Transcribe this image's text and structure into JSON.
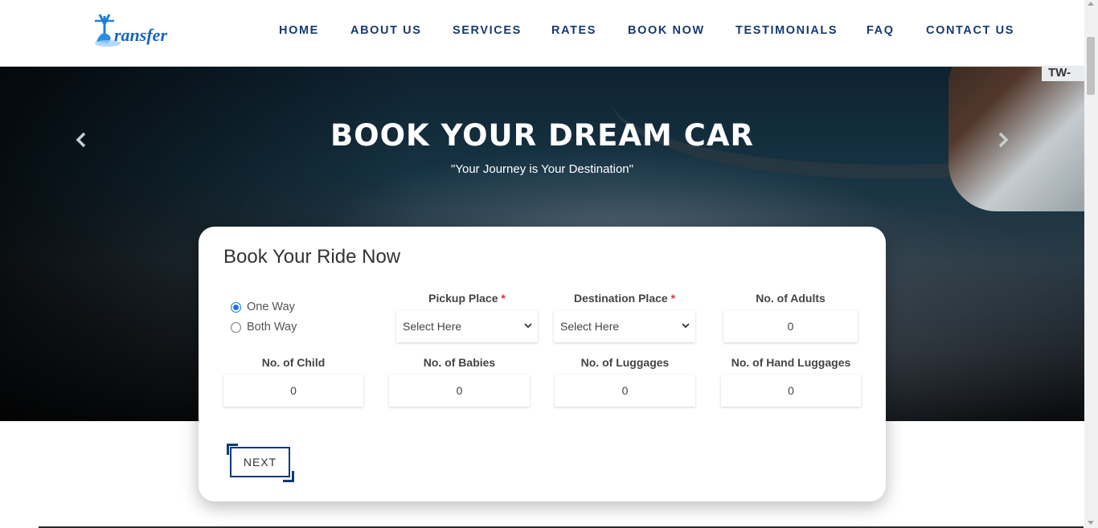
{
  "header": {
    "logo_text": "Transfer",
    "nav": [
      "HOME",
      "ABOUT US",
      "SERVICES",
      "RATES",
      "BOOK NOW",
      "TESTIMONIALS",
      "FAQ",
      "CONTACT US"
    ]
  },
  "hero": {
    "title": "BOOK YOUR DREAM CAR",
    "subtitle": "\"Your Journey is Your Destination\"",
    "plate_text": "TW-",
    "prev_icon": "chevron-left-icon",
    "next_icon": "chevron-right-icon"
  },
  "form": {
    "title": "Book Your Ride Now",
    "trip_type": {
      "options": [
        "One Way",
        "Both Way"
      ],
      "selected": "One Way"
    },
    "pickup": {
      "label": "Pickup Place",
      "required_mark": "*",
      "value": "Select Here"
    },
    "destination": {
      "label": "Destination Place",
      "required_mark": "*",
      "value": "Select Here"
    },
    "adults": {
      "label": "No. of Adults",
      "value": "0"
    },
    "child": {
      "label": "No. of Child",
      "value": "0"
    },
    "babies": {
      "label": "No. of Babies",
      "value": "0"
    },
    "luggages": {
      "label": "No. of Luggages",
      "value": "0"
    },
    "hand_luggages": {
      "label": "No. of Hand Luggages",
      "value": "0"
    },
    "next_label": "NEXT"
  },
  "colors": {
    "nav_text": "#173a72",
    "accent": "#0d3a7a",
    "radio_selected": "#1a73e8",
    "required": "#dd3333"
  }
}
